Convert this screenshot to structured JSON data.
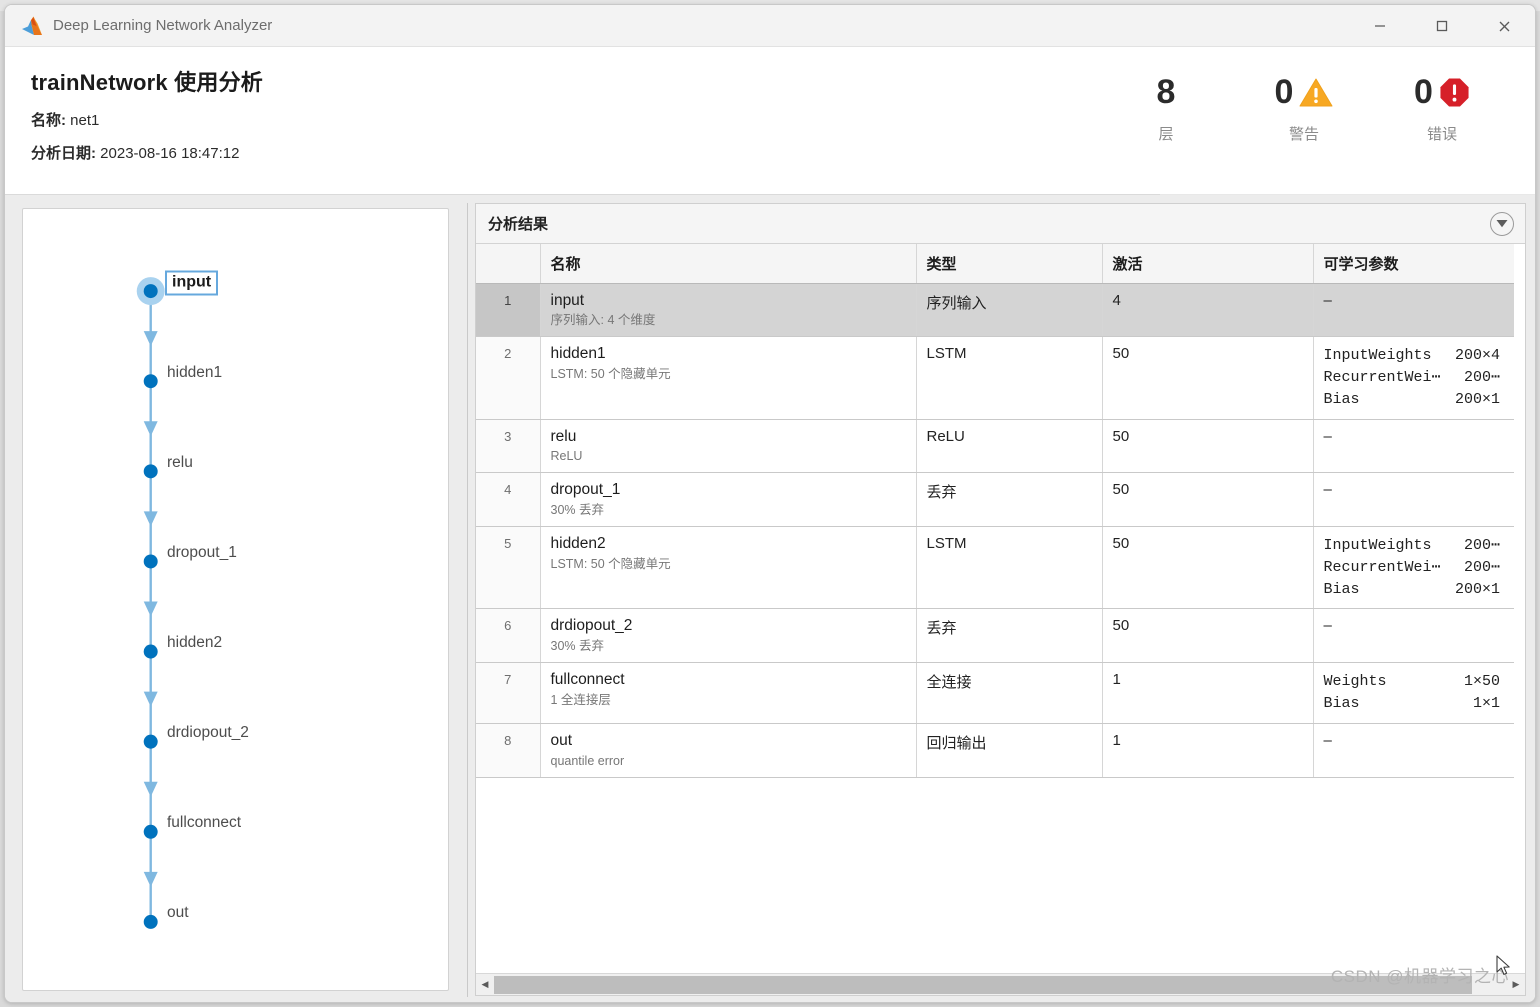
{
  "background_strip": {
    "ghost_text": "▪ ▪▪▪▪ ▪ ▪ ▪▪ ▪▪ ▪▪▪▪▪▪▪▪▪     ▪▪▪▪ ▪ ▪▪ ▪▪▪▪       ▪▪▪▪▪▪▪▪ ▪▪▪▪▪       ▪ ▪▪▪▪ ▪"
  },
  "titlebar": {
    "title": "Deep Learning Network Analyzer",
    "app_icon": "matlab-membrane-icon",
    "minimize": "minimize-icon",
    "maximize": "maximize-icon",
    "close": "close-icon"
  },
  "header": {
    "title": "trainNetwork 使用分析",
    "name_label": "名称:",
    "name_value": "net1",
    "date_label": "分析日期:",
    "date_value": "2023-08-16 18:47:12"
  },
  "summary": [
    {
      "count": "8",
      "label": "层",
      "icon": "none"
    },
    {
      "count": "0",
      "label": "警告",
      "icon": "warning-triangle-icon",
      "color": "#f5a623"
    },
    {
      "count": "0",
      "label": "错误",
      "icon": "error-octagon-icon",
      "color": "#d0021b"
    }
  ],
  "graph": {
    "accent": "#0072bd",
    "edge_color": "#7fb8e0",
    "nodes": [
      {
        "label": "input",
        "selected": true
      },
      {
        "label": "hidden1",
        "selected": false
      },
      {
        "label": "relu",
        "selected": false
      },
      {
        "label": "dropout_1",
        "selected": false
      },
      {
        "label": "hidden2",
        "selected": false
      },
      {
        "label": "drdiopout_2",
        "selected": false
      },
      {
        "label": "fullconnect",
        "selected": false
      },
      {
        "label": "out",
        "selected": false
      }
    ]
  },
  "results_panel": {
    "title": "分析结果",
    "collapse_icon": "chevron-down-icon",
    "columns": [
      "",
      "名称",
      "类型",
      "激活",
      "可学习参数"
    ],
    "rows": [
      {
        "index": "1",
        "name": "input",
        "sub": "序列输入: 4 个维度",
        "type": "序列输入",
        "activations": "4",
        "learnables": [],
        "learnables_dash": "–",
        "selected": true
      },
      {
        "index": "2",
        "name": "hidden1",
        "sub": "LSTM: 50 个隐藏单元",
        "type": "LSTM",
        "activations": "50",
        "learnables": [
          {
            "name": "InputWeights",
            "size": "200×4"
          },
          {
            "name": "RecurrentWei⋯",
            "size": "200⋯"
          },
          {
            "name": "Bias",
            "size": "200×1"
          }
        ],
        "learnables_dash": "",
        "selected": false
      },
      {
        "index": "3",
        "name": "relu",
        "sub": "ReLU",
        "type": "ReLU",
        "activations": "50",
        "learnables": [],
        "learnables_dash": "–",
        "selected": false
      },
      {
        "index": "4",
        "name": "dropout_1",
        "sub": "30% 丢弃",
        "type": "丢弃",
        "activations": "50",
        "learnables": [],
        "learnables_dash": "–",
        "selected": false
      },
      {
        "index": "5",
        "name": "hidden2",
        "sub": "LSTM: 50 个隐藏单元",
        "type": "LSTM",
        "activations": "50",
        "learnables": [
          {
            "name": "InputWeights",
            "size": "200⋯"
          },
          {
            "name": "RecurrentWei⋯",
            "size": "200⋯"
          },
          {
            "name": "Bias",
            "size": "200×1"
          }
        ],
        "learnables_dash": "",
        "selected": false
      },
      {
        "index": "6",
        "name": "drdiopout_2",
        "sub": "30% 丢弃",
        "type": "丢弃",
        "activations": "50",
        "learnables": [],
        "learnables_dash": "–",
        "selected": false
      },
      {
        "index": "7",
        "name": "fullconnect",
        "sub": "1 全连接层",
        "type": "全连接",
        "activations": "1",
        "learnables": [
          {
            "name": "Weights",
            "size": "1×50"
          },
          {
            "name": "Bias",
            "size": "1×1"
          }
        ],
        "learnables_dash": "",
        "selected": false
      },
      {
        "index": "8",
        "name": "out",
        "sub": "quantile error",
        "type": "回归输出",
        "activations": "1",
        "learnables": [],
        "learnables_dash": "–",
        "selected": false
      }
    ],
    "scrollbar": {
      "left_arrow": "◀",
      "right_arrow": "▶"
    }
  },
  "watermark": "CSDN @机器学习之心"
}
